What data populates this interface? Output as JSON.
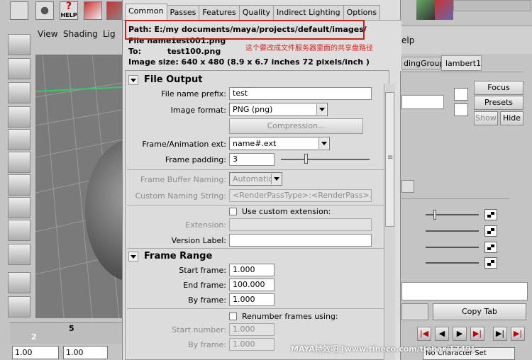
{
  "maya": {
    "help_icon_label": "HELP",
    "panel_menu": [
      "View",
      "Shading",
      "Lig"
    ],
    "time_ticks": [
      "2",
      "5"
    ],
    "frame_fields": [
      "1.00",
      "1.00"
    ],
    "right_menu_fragment": "elp",
    "right_tabs": [
      "dingGroup",
      "lambert1"
    ],
    "right_buttons": {
      "focus": "Focus",
      "presets": "Presets",
      "show": "Show",
      "hide": "Hide",
      "copy_tab": "Copy Tab"
    },
    "character_set": "No Character Set"
  },
  "render_settings": {
    "tabs": [
      "Common",
      "Passes",
      "Features",
      "Quality",
      "Indirect Lighting",
      "Options"
    ],
    "active_tab": "Common",
    "info": {
      "path": "Path: E:/my documents/maya/projects/default/images/",
      "file_name_label": "File name:",
      "file_name": "test001.png",
      "to_label": "To:",
      "to_value": "test100.png",
      "image_size": "Image size: 640 x 480 (8.9 x 6.7 inches 72 pixels/inch )"
    },
    "annotation": "这个要改成文件服务器里面的共享盘路径",
    "file_output": {
      "title": "File Output",
      "prefix_label": "File name prefix:",
      "prefix_value": "test",
      "format_label": "Image format:",
      "format_value": "PNG (png)",
      "compression_label": "Compression...",
      "frame_ext_label": "Frame/Animation ext:",
      "frame_ext_value": "name#.ext",
      "padding_label": "Frame padding:",
      "padding_value": "3",
      "padding_slider_level": 0.28,
      "fb_naming_label": "Frame Buffer Naming:",
      "fb_naming_value": "Automatic",
      "custom_naming_label": "Custom Naming String:",
      "custom_naming_value": "<RenderPassType>:<RenderPass>.<Car",
      "use_custom_ext_label": "Use custom extension:",
      "extension_label": "Extension:",
      "version_label": "Version Label:"
    },
    "frame_range": {
      "title": "Frame Range",
      "start_label": "Start frame:",
      "start_value": "1.000",
      "end_label": "End frame:",
      "end_value": "100.000",
      "by_label": "By frame:",
      "by_value": "1.000",
      "renumber_label": "Renumber frames using:",
      "start_number_label": "Start number:",
      "start_number_value": "1.000",
      "by_frame2_label": "By frame:",
      "by_frame2_value": "1.000"
    }
  },
  "watermark": "MAYA特效吧  [www.tineco.com/tiebar/1749]",
  "colors": {
    "annotation": "#dd2222",
    "highlight_box": "#c6201e",
    "window_bg": "#dedede"
  }
}
